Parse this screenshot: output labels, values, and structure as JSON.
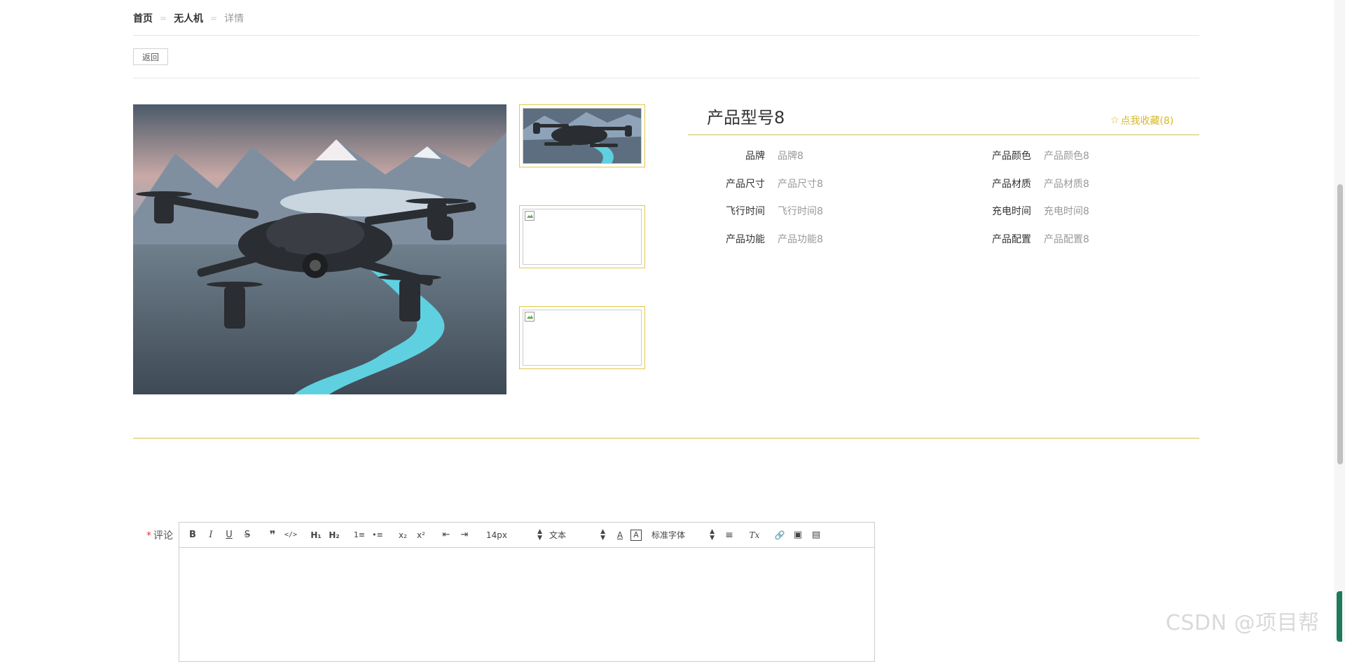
{
  "breadcrumb": {
    "home": "首页",
    "category": "无人机",
    "current": "详情",
    "separator": "="
  },
  "back_button": "返回",
  "product": {
    "title": "产品型号8",
    "favorite": "点我收藏(8)",
    "specs_left": [
      {
        "label": "品牌",
        "value": "品牌8"
      },
      {
        "label": "产品尺寸",
        "value": "产品尺寸8"
      },
      {
        "label": "飞行时间",
        "value": "飞行时间8"
      },
      {
        "label": "产品功能",
        "value": "产品功能8"
      }
    ],
    "specs_right": [
      {
        "label": "产品颜色",
        "value": "产品颜色8"
      },
      {
        "label": "产品材质",
        "value": "产品材质8"
      },
      {
        "label": "充电时间",
        "value": "充电时间8"
      },
      {
        "label": "产品配置",
        "value": "产品配置8"
      }
    ]
  },
  "comment": {
    "label": "评论",
    "required_mark": "*",
    "toolbar": {
      "bold": "B",
      "italic": "I",
      "underline": "U",
      "strike": "S",
      "quote": "❞",
      "code": "</>",
      "h1": "H₁",
      "h2": "H₂",
      "ordered_list": "1≡",
      "bullet_list": "•≡",
      "subscript": "x₂",
      "superscript": "x²",
      "outdent": "⇤",
      "indent": "⇥",
      "size_select": "14px",
      "header_select": "文本",
      "text_color": "A",
      "background_color": "A",
      "font_select": "标准字体",
      "align": "≡",
      "clean": "Tx",
      "link": "🔗",
      "image": "▣",
      "video": "▤"
    }
  },
  "watermark": "CSDN @项目帮",
  "colors": {
    "accent": "#d8b826",
    "divider": "#d8c14a"
  }
}
